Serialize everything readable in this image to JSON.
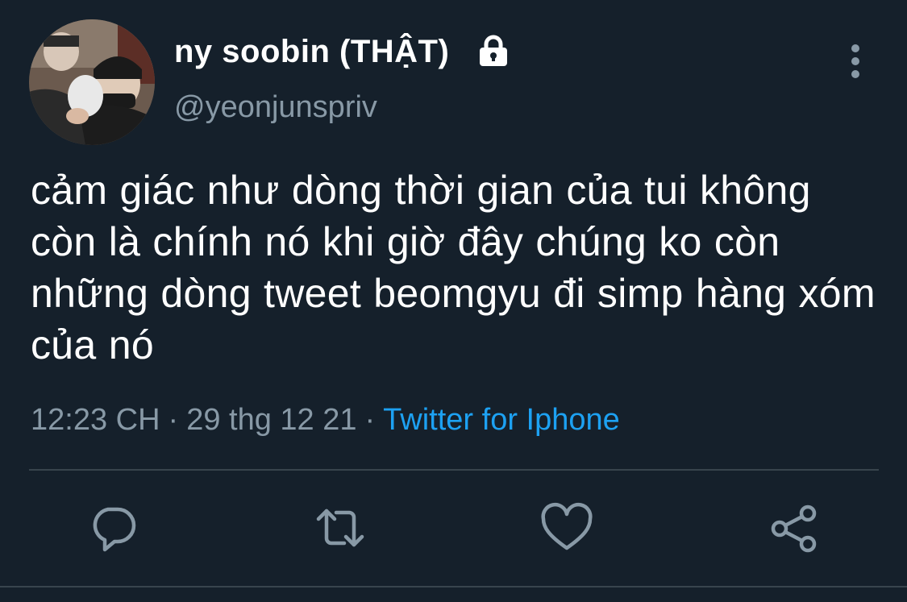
{
  "user": {
    "display_name": "ny soobin (THẬT)",
    "handle": "@yeonjunspriv",
    "avatar_icon": "profile-photo",
    "protected_icon": "lock-icon"
  },
  "tweet": {
    "text": "cảm giác như dòng thời gian của tui không còn là chính nó khi giờ đây chúng ko còn những dòng tweet beomgyu đi simp hàng xóm của nó",
    "time": "12:23 CH",
    "separator": "·",
    "date": "29 thg 12 21",
    "source": "Twitter for Iphone"
  },
  "actions": {
    "reply_icon": "reply-icon",
    "retweet_icon": "retweet-icon",
    "like_icon": "heart-icon",
    "share_icon": "share-icon",
    "more_icon": "more-vertical-icon"
  },
  "colors": {
    "background": "#15202b",
    "text": "#ffffff",
    "secondary": "#8899a6",
    "link": "#1da1f2",
    "divider": "#38444d"
  }
}
